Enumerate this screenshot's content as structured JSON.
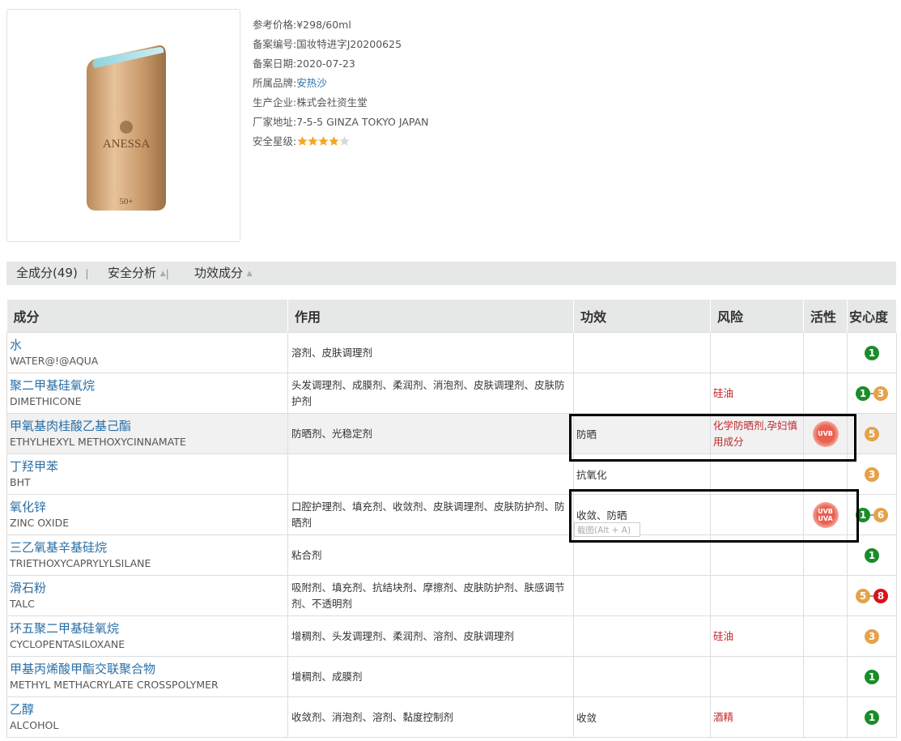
{
  "product": {
    "image_alt": "ANESSA",
    "bottle_brand": "ANESSA",
    "bottle_sub": "perfect UV sunscreen skincare milk",
    "bottle_spf": "50+"
  },
  "info": [
    {
      "label": "参考价格:",
      "value": "¥298/60ml"
    },
    {
      "label": "备案编号:",
      "value": "国妆特进字J20200625"
    },
    {
      "label": "备案日期:",
      "value": "2020-07-23"
    },
    {
      "label": "所属品牌:",
      "value": "安热沙",
      "link": true
    },
    {
      "label": "生产企业:",
      "value": "株式会社资生堂"
    },
    {
      "label": "厂家地址:",
      "value": "7-5-5 GINZA TOKYO JAPAN"
    },
    {
      "label": "安全星级:",
      "value": ""
    }
  ],
  "rating": {
    "stars": 4,
    "max": 5
  },
  "tabs": [
    {
      "label": "全成分(49)"
    },
    {
      "label": "安全分析"
    },
    {
      "label": "功效成分"
    }
  ],
  "table": {
    "headers": [
      "成分",
      "作用",
      "功效",
      "风险",
      "活性",
      "安心度"
    ],
    "rows": [
      {
        "cn": "水",
        "en": "WATER@!@AQUA",
        "func": "溶剂、皮肤调理剂",
        "eff": "",
        "risk": "",
        "uv": "",
        "safety": [
          {
            "v": "1",
            "c": "green"
          }
        ]
      },
      {
        "cn": "聚二甲基硅氧烷",
        "en": "DIMETHICONE",
        "func": "头发调理剂、成膜剂、柔润剂、消泡剂、皮肤调理剂、皮肤防护剂",
        "eff": "",
        "risk": "硅油",
        "uv": "",
        "safety": [
          {
            "v": "1",
            "c": "green"
          },
          {
            "v": "3",
            "c": "orange"
          }
        ]
      },
      {
        "cn": "甲氧基肉桂酸乙基己酯",
        "en": "ETHYLHEXYL METHOXYCINNAMATE",
        "func": "防晒剂、光稳定剂",
        "eff": "防晒",
        "risk": "化学防晒剂,孕妇慎用成分",
        "uv": "UVB",
        "safety": [
          {
            "v": "5",
            "c": "orange"
          }
        ],
        "hl": true
      },
      {
        "cn": "丁羟甲苯",
        "en": "BHT",
        "func": "",
        "eff": "抗氧化",
        "risk": "",
        "uv": "",
        "safety": [
          {
            "v": "3",
            "c": "orange"
          }
        ]
      },
      {
        "cn": "氧化锌",
        "en": "ZINC OXIDE",
        "func": "口腔护理剂、填充剂、收敛剂、皮肤调理剂、皮肤防护剂、防晒剂",
        "eff": "收敛、防晒",
        "risk": "",
        "uv": "UVB UVA",
        "safety": [
          {
            "v": "1",
            "c": "green"
          },
          {
            "v": "6",
            "c": "orange"
          }
        ]
      },
      {
        "cn": "三乙氧基辛基硅烷",
        "en": "TRIETHOXYCAPRYLYLSILANE",
        "func": "粘合剂",
        "eff": "",
        "risk": "",
        "uv": "",
        "safety": [
          {
            "v": "1",
            "c": "green"
          }
        ]
      },
      {
        "cn": "滑石粉",
        "en": "TALC",
        "func": "吸附剂、填充剂、抗结块剂、摩擦剂、皮肤防护剂、肤感调节剂、不透明剂",
        "eff": "",
        "risk": "",
        "uv": "",
        "safety": [
          {
            "v": "5",
            "c": "orange"
          },
          {
            "v": "8",
            "c": "red"
          }
        ]
      },
      {
        "cn": "环五聚二甲基硅氧烷",
        "en": "CYCLOPENTASILOXANE",
        "func": "增稠剂、头发调理剂、柔润剂、溶剂、皮肤调理剂",
        "eff": "",
        "risk": "硅油",
        "uv": "",
        "safety": [
          {
            "v": "3",
            "c": "orange"
          }
        ]
      },
      {
        "cn": "甲基丙烯酸甲酯交联聚合物",
        "en": "METHYL METHACRYLATE CROSSPOLYMER",
        "func": "增稠剂、成膜剂",
        "eff": "",
        "risk": "",
        "uv": "",
        "safety": [
          {
            "v": "1",
            "c": "green"
          }
        ]
      },
      {
        "cn": "乙醇",
        "en": "ALCOHOL",
        "func": "收敛剂、消泡剂、溶剂、黏度控制剂",
        "eff": "收敛",
        "risk": "酒精",
        "uv": "",
        "safety": [
          {
            "v": "1",
            "c": "green"
          }
        ]
      }
    ]
  },
  "tooltip": "截图(Alt + A)",
  "colors": {
    "link": "#2a6fa7",
    "risk": "#c0282d",
    "green": "#1a8c2a",
    "orange": "#e4a24a",
    "red": "#d8141a",
    "star": "#f5a623"
  }
}
